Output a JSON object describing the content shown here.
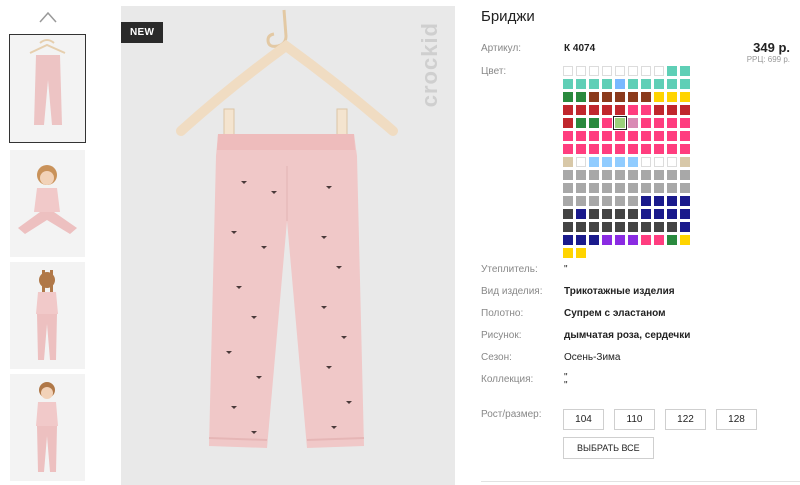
{
  "thumbnails": {
    "up_arrow": "chevron-up-icon",
    "items": [
      "thumb-pants",
      "thumb-girl-sitting",
      "thumb-girl-back",
      "thumb-girl-front"
    ]
  },
  "main_image": {
    "badge": "NEW",
    "brand": "crockid"
  },
  "product": {
    "title": "Бриджи",
    "article_label": "Артикул:",
    "article_value": "К 4074",
    "price": "349 р.",
    "rrp": "РРЦ: 699 р.",
    "color_label": "Цвет:",
    "swatches": [
      "#ffffff",
      "#ffffff",
      "#ffffff",
      "#ffffff",
      "#ffffff",
      "#ffffff",
      "#ffffff",
      "#ffffff",
      "#5fcfb6",
      "#5fcfb6",
      "#5fcfb6",
      "#5fcfb6",
      "#5fcfb6",
      "#5fcfb6",
      "#79b8ff",
      "#5fcfb6",
      "#5fcfb6",
      "#5fcfb6",
      "#5fcfb6",
      "#5fcfb6",
      "#2a8a3e",
      "#2a8a3e",
      "#8b3a1c",
      "#8b3a1c",
      "#8b3a1c",
      "#8b3a1c",
      "#8b3a1c",
      "#ffd400",
      "#ffd400",
      "#ffd400",
      "#c0272d",
      "#c0272d",
      "#c0272d",
      "#c0272d",
      "#c0272d",
      "#ff3d7f",
      "#ff3d7f",
      "#c0272d",
      "#c0272d",
      "#c0272d",
      "#c0272d",
      "#2a8a3e",
      "#2a8a3e",
      "#ff3d7f",
      "#9ad17a",
      "#d98ab4",
      "#ff3d7f",
      "#ff3d7f",
      "#ff3d7f",
      "#ff3d7f",
      "#ff3d7f",
      "#ff3d7f",
      "#ff3d7f",
      "#ff3d7f",
      "#ff3d7f",
      "#ff3d7f",
      "#ff3d7f",
      "#ff3d7f",
      "#ff3d7f",
      "#ff3d7f",
      "#ff3d7f",
      "#ff3d7f",
      "#ff3d7f",
      "#ff3d7f",
      "#ff3d7f",
      "#ff3d7f",
      "#ff3d7f",
      "#ff3d7f",
      "#ff3d7f",
      "#ff3d7f",
      "#d8c8a8",
      "#ffffff",
      "#90ccff",
      "#90ccff",
      "#90ccff",
      "#90ccff",
      "#ffffff",
      "#ffffff",
      "#ffffff",
      "#d8c8a8",
      "#a8a8a8",
      "#a8a8a8",
      "#a8a8a8",
      "#a8a8a8",
      "#a8a8a8",
      "#a8a8a8",
      "#a8a8a8",
      "#a8a8a8",
      "#a8a8a8",
      "#a8a8a8",
      "#a8a8a8",
      "#a8a8a8",
      "#a8a8a8",
      "#a8a8a8",
      "#a8a8a8",
      "#a8a8a8",
      "#a8a8a8",
      "#a8a8a8",
      "#a8a8a8",
      "#a8a8a8",
      "#a8a8a8",
      "#a8a8a8",
      "#a8a8a8",
      "#a8a8a8",
      "#a8a8a8",
      "#a8a8a8",
      "#1a1a8c",
      "#1a1a8c",
      "#1a1a8c",
      "#1a1a8c",
      "#444444",
      "#1a1a8c",
      "#444444",
      "#444444",
      "#444444",
      "#444444",
      "#1a1a8c",
      "#1a1a8c",
      "#1a1a8c",
      "#1a1a8c",
      "#444444",
      "#444444",
      "#444444",
      "#444444",
      "#444444",
      "#444444",
      "#444444",
      "#444444",
      "#444444",
      "#1a1a8c",
      "#1a1a8c",
      "#1a1a8c",
      "#1a1a8c",
      "#8a2be2",
      "#8a2be2",
      "#8a2be2",
      "#ff3d7f",
      "#ff3d7f",
      "#2a8a3e",
      "#ffd400",
      "#ffd400",
      "#ffd400"
    ],
    "selected_swatch_index": 44,
    "specs": [
      {
        "label": "Утеплитель:",
        "value": "\""
      },
      {
        "label": "Вид изделия:",
        "value": "Трикотажные изделия"
      },
      {
        "label": "Полотно:",
        "value": "Супрем с эластаном"
      },
      {
        "label": "Рисунок:",
        "value": "дымчатая роза, сердечки"
      },
      {
        "label": "Сезон:",
        "value": "Осень-Зима"
      },
      {
        "label": "Коллекция:",
        "value": "\"\n\""
      }
    ],
    "size_label": "Рост/размер:",
    "sizes": [
      "104",
      "110",
      "122",
      "128"
    ],
    "select_all": "ВЫБРАТЬ ВСЕ"
  }
}
